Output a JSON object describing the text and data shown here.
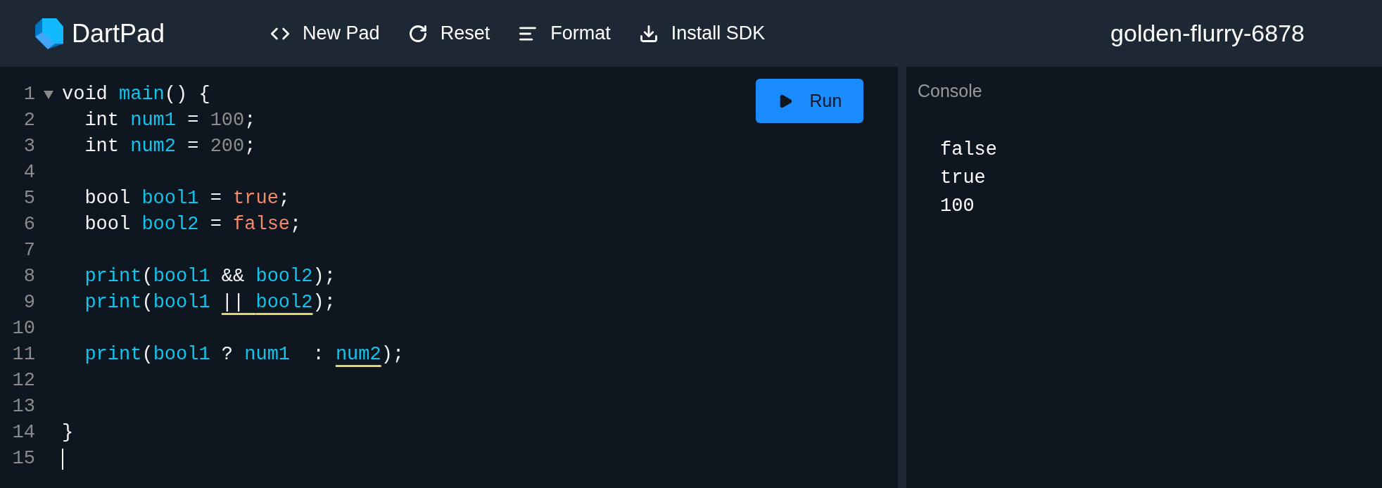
{
  "header": {
    "app_name": "DartPad",
    "actions": [
      {
        "label": "New Pad",
        "kind": "code"
      },
      {
        "label": "Reset",
        "kind": "reset"
      },
      {
        "label": "Format",
        "kind": "format"
      },
      {
        "label": "Install SDK",
        "kind": "download"
      }
    ],
    "pad_name": "golden-flurry-6878"
  },
  "editor": {
    "run_button": "Run",
    "lines": [
      {
        "number": "1",
        "foldable": true,
        "cursor": false,
        "tokens": [
          {
            "text": "void ",
            "kind": "keyword",
            "warning": false
          },
          {
            "text": "main",
            "kind": "ident",
            "warning": false
          },
          {
            "text": "() {",
            "kind": "punct",
            "warning": false
          }
        ]
      },
      {
        "number": "2",
        "foldable": false,
        "cursor": false,
        "tokens": [
          {
            "text": "  int ",
            "kind": "keyword",
            "warning": false
          },
          {
            "text": "num1",
            "kind": "ident",
            "warning": false
          },
          {
            "text": " = ",
            "kind": "punct",
            "warning": false
          },
          {
            "text": "100",
            "kind": "number",
            "warning": false
          },
          {
            "text": ";",
            "kind": "punct",
            "warning": false
          }
        ]
      },
      {
        "number": "3",
        "foldable": false,
        "cursor": false,
        "tokens": [
          {
            "text": "  int ",
            "kind": "keyword",
            "warning": false
          },
          {
            "text": "num2",
            "kind": "ident",
            "warning": false
          },
          {
            "text": " = ",
            "kind": "punct",
            "warning": false
          },
          {
            "text": "200",
            "kind": "number",
            "warning": false
          },
          {
            "text": ";",
            "kind": "punct",
            "warning": false
          }
        ]
      },
      {
        "number": "4",
        "foldable": false,
        "cursor": false
      },
      {
        "number": "5",
        "foldable": false,
        "cursor": false,
        "tokens": [
          {
            "text": "  bool ",
            "kind": "keyword",
            "warning": false
          },
          {
            "text": "bool1",
            "kind": "ident",
            "warning": false
          },
          {
            "text": " = ",
            "kind": "punct",
            "warning": false
          },
          {
            "text": "true",
            "kind": "literal",
            "warning": false
          },
          {
            "text": ";",
            "kind": "punct",
            "warning": false
          }
        ]
      },
      {
        "number": "6",
        "foldable": false,
        "cursor": false,
        "tokens": [
          {
            "text": "  bool ",
            "kind": "keyword",
            "warning": false
          },
          {
            "text": "bool2",
            "kind": "ident",
            "warning": false
          },
          {
            "text": " = ",
            "kind": "punct",
            "warning": false
          },
          {
            "text": "false",
            "kind": "literal",
            "warning": false
          },
          {
            "text": ";",
            "kind": "punct",
            "warning": false
          }
        ]
      },
      {
        "number": "7",
        "foldable": false,
        "cursor": false
      },
      {
        "number": "8",
        "foldable": false,
        "cursor": false,
        "tokens": [
          {
            "text": "  print",
            "kind": "ident",
            "warning": false
          },
          {
            "text": "(",
            "kind": "punct",
            "warning": false
          },
          {
            "text": "bool1",
            "kind": "ident",
            "warning": false
          },
          {
            "text": " && ",
            "kind": "punct",
            "warning": false
          },
          {
            "text": "bool2",
            "kind": "ident",
            "warning": false
          },
          {
            "text": ");",
            "kind": "punct",
            "warning": false
          }
        ]
      },
      {
        "number": "9",
        "foldable": false,
        "cursor": false,
        "tokens": [
          {
            "text": "  print",
            "kind": "ident",
            "warning": false
          },
          {
            "text": "(",
            "kind": "punct",
            "warning": false
          },
          {
            "text": "bool1 ",
            "kind": "ident",
            "warning": false
          },
          {
            "text": "|| ",
            "kind": "punct",
            "warning": true
          },
          {
            "text": "bool2",
            "kind": "ident",
            "warning": true
          },
          {
            "text": ");",
            "kind": "punct",
            "warning": false
          }
        ]
      },
      {
        "number": "10",
        "foldable": false,
        "cursor": false
      },
      {
        "number": "11",
        "foldable": false,
        "cursor": false,
        "tokens": [
          {
            "text": "  print",
            "kind": "ident",
            "warning": false
          },
          {
            "text": "(",
            "kind": "punct",
            "warning": false
          },
          {
            "text": "bool1",
            "kind": "ident",
            "warning": false
          },
          {
            "text": " ? ",
            "kind": "punct",
            "warning": false
          },
          {
            "text": "num1",
            "kind": "ident",
            "warning": false
          },
          {
            "text": "  : ",
            "kind": "punct",
            "warning": false
          },
          {
            "text": "num2",
            "kind": "ident",
            "warning": true
          },
          {
            "text": ");",
            "kind": "punct",
            "warning": false
          }
        ]
      },
      {
        "number": "12",
        "foldable": false,
        "cursor": false
      },
      {
        "number": "13",
        "foldable": false,
        "cursor": false
      },
      {
        "number": "14",
        "foldable": false,
        "cursor": false,
        "tokens": [
          {
            "text": "}",
            "kind": "punct",
            "warning": false
          }
        ]
      },
      {
        "number": "15",
        "foldable": false,
        "cursor": true
      }
    ]
  },
  "console": {
    "title": "Console",
    "output": [
      "false",
      "true",
      "100"
    ]
  }
}
